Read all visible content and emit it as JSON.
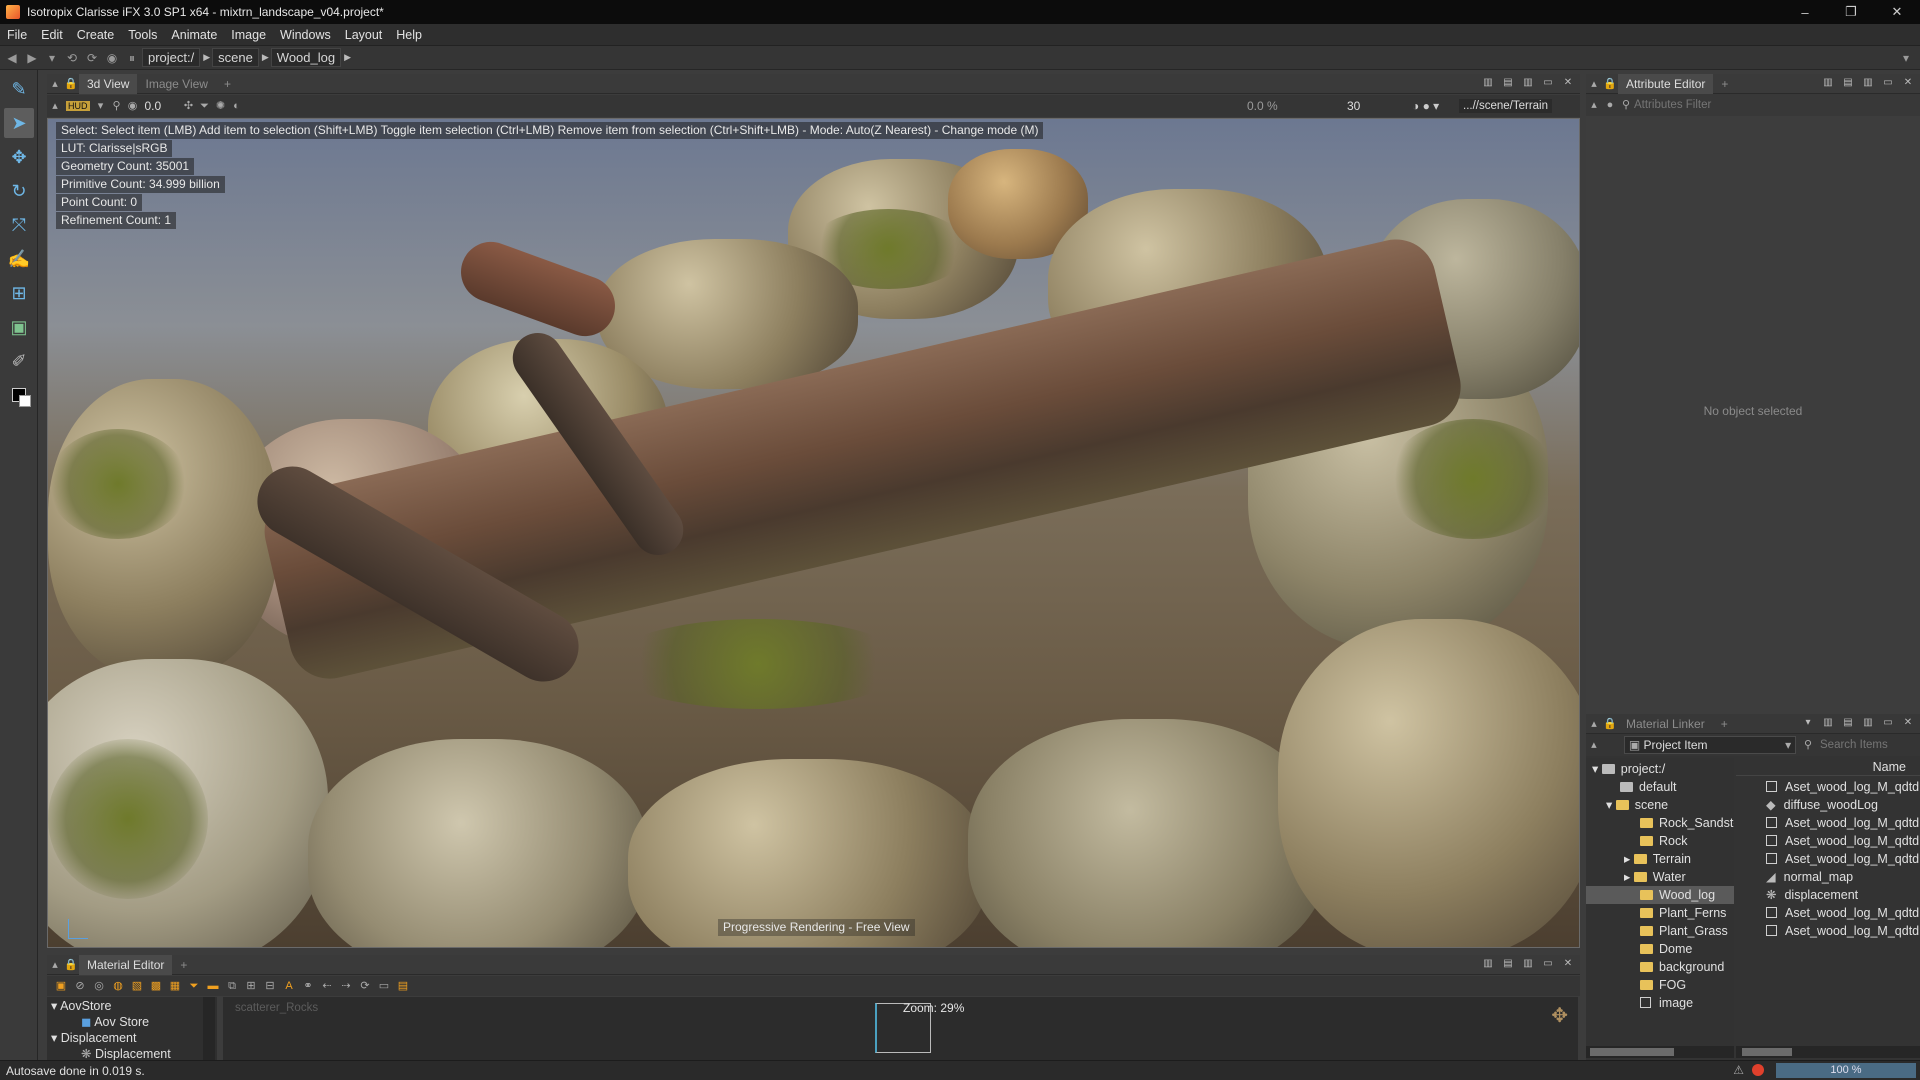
{
  "titlebar": {
    "title": "Isotropix Clarisse iFX 3.0 SP1 x64  - mixtrn_landscape_v04.project*",
    "minimize": "–",
    "maximize": "❐",
    "close": "✕"
  },
  "menu": [
    "File",
    "Edit",
    "Create",
    "Tools",
    "Animate",
    "Image",
    "Windows",
    "Layout",
    "Help"
  ],
  "address": {
    "crumbs": [
      "project:/",
      "scene",
      "Wood_log"
    ]
  },
  "view_panel": {
    "tabs": [
      "3d View",
      "Image View"
    ],
    "add_tab": "+",
    "hud_label": "HUD",
    "field_a": "0.0",
    "field_b": "0.0 %",
    "field_c": "30",
    "path": "...//scene/Terrain"
  },
  "hud": {
    "select": "Select: Select item (LMB)  Add item to selection (Shift+LMB)  Toggle item selection (Ctrl+LMB)  Remove item from selection (Ctrl+Shift+LMB)  - Mode: Auto(Z Nearest) - Change mode (M)",
    "lut": "LUT: Clarisse|sRGB",
    "geometry": "Geometry Count: 35001",
    "primitive": "Primitive Count: 34.999 billion",
    "point": "Point Count: 0",
    "refinement": "Refinement Count: 1",
    "footer": "Progressive Rendering - Free View"
  },
  "material_editor": {
    "tab": "Material Editor",
    "add_tab": "+",
    "tree": [
      {
        "label": "AovStore",
        "child": "Aov Store"
      },
      {
        "label": "Displacement",
        "child": "Displacement"
      }
    ],
    "node_label": "scatterer_Rocks",
    "zoom": "Zoom: 29%"
  },
  "attribute_editor": {
    "tab": "Attribute Editor",
    "add_tab": "+",
    "filter_placeholder": "Attributes Filter",
    "empty": "No object selected"
  },
  "material_linker": {
    "tab": "Material Linker",
    "add_tab": "+",
    "dropdown": "Project Item",
    "search_placeholder": "Search Items",
    "name_header": "Name",
    "tree": [
      "project:/",
      "default",
      "scene",
      "Rock_Sandsto",
      "Rock",
      "Terrain",
      "Water",
      "Wood_log",
      "Plant_Ferns",
      "Plant_Grass",
      "Dome",
      "background",
      "FOG",
      "image"
    ],
    "items": [
      "Aset_wood_log_M_qdtdP",
      "diffuse_woodLog",
      "Aset_wood_log_M_qdtdP",
      "Aset_wood_log_M_qdtdP",
      "Aset_wood_log_M_qdtdP",
      "normal_map",
      "displacement",
      "Aset_wood_log_M_qdtdP",
      "Aset_wood_log_M_qdtdP"
    ]
  },
  "status": {
    "message": "Autosave done in 0.019 s.",
    "progress": "100 %"
  }
}
